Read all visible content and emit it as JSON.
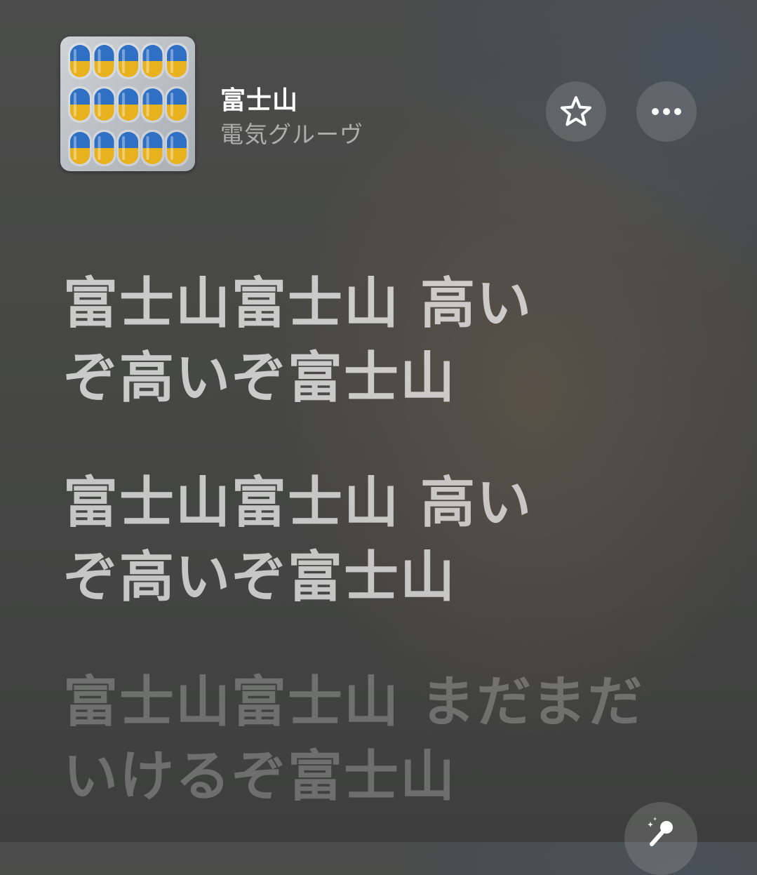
{
  "now_playing": {
    "title": "富士山",
    "artist": "電気グルーヴ",
    "artwork_icon": "pill-capsules-album-art"
  },
  "controls": {
    "favorite_icon": "star-icon",
    "more_icon": "ellipsis-icon",
    "singer_icon": "microphone-icon"
  },
  "lyrics": [
    {
      "lines": [
        "富士山富士山 高い",
        "ぞ高いぞ富士山"
      ],
      "state": "active"
    },
    {
      "lines": [
        "富士山富士山 高い",
        "ぞ高いぞ富士山"
      ],
      "state": "active"
    },
    {
      "lines": [
        "富士山富士山 まだまだ",
        "いけるぞ富士山"
      ],
      "state": "upcoming"
    }
  ],
  "colors": {
    "capsule_blue": "#2f6fc4",
    "capsule_yellow": "#e8b21f",
    "text_primary": "#ffffff"
  }
}
